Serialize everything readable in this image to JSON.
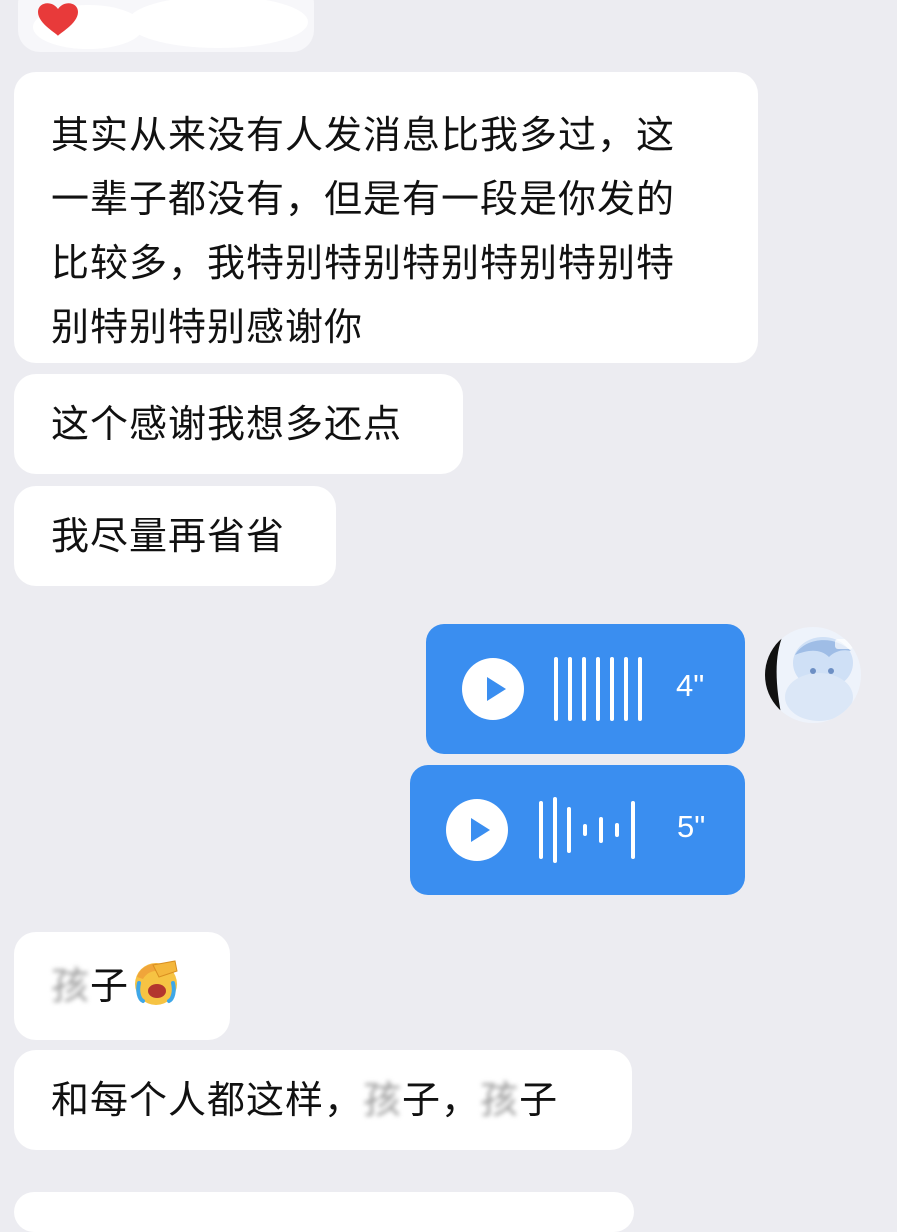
{
  "colors": {
    "background": "#ececf1",
    "incoming_bubble": "#ffffff",
    "voice_bubble": "#3a8ef0",
    "text": "#111111",
    "heart": "#e83a3a"
  },
  "messages": [
    {
      "side": "left",
      "text": "其实从来没有人发消息比我多过，这\n一辈子都没有，但是有一段是你发的\n比较多，我特别特别特别特别特别特\n别特别特别感谢你"
    },
    {
      "side": "left",
      "text": "这个感谢我想多还点"
    },
    {
      "side": "left",
      "text": "我尽量再省省"
    }
  ],
  "voice_messages": [
    {
      "side": "right",
      "duration": "4\"",
      "play_icon": "play-icon",
      "waveform_icon": "waveform-icon"
    },
    {
      "side": "right",
      "duration": "5\"",
      "play_icon": "play-icon",
      "waveform_icon": "waveform-icon"
    }
  ],
  "later_messages": [
    {
      "side": "left",
      "obscured": "孩",
      "rest": "子",
      "emoji": "face-palm-crying-emoji"
    },
    {
      "side": "left",
      "prefix": "和每个人都这样，",
      "obscured_1": "孩",
      "mid": "子，",
      "obscured_2": "孩",
      "suffix": "子"
    }
  ],
  "top_partial": {
    "icon": "heart-icon"
  },
  "avatar": {
    "icon": "avatar-image"
  }
}
